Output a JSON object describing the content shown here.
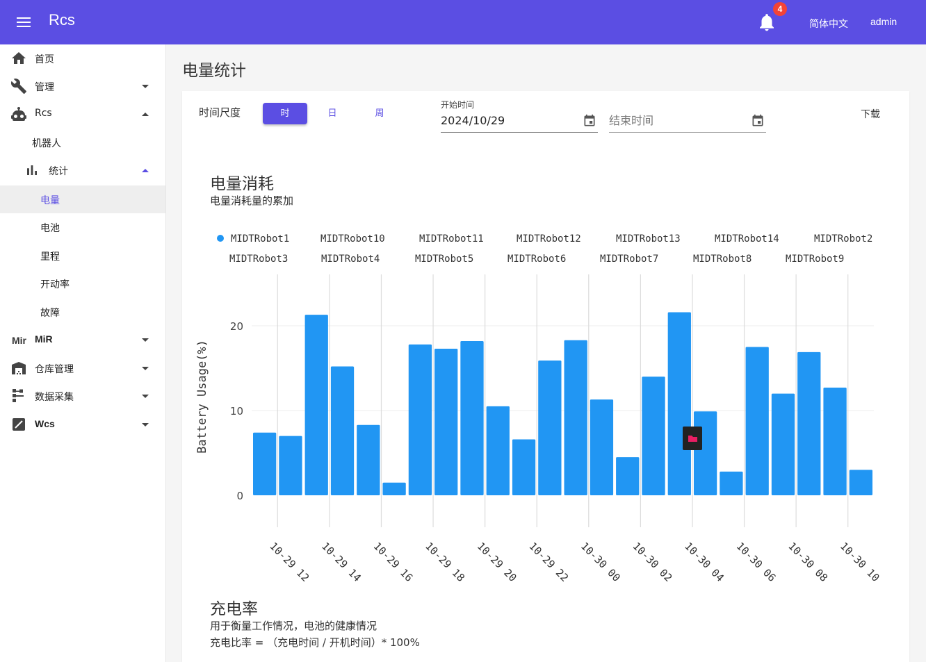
{
  "header": {
    "app_title": "Rcs",
    "notification_count": "4",
    "language": "简体中文",
    "user": "admin"
  },
  "sidebar": {
    "items": [
      {
        "label": "首页",
        "icon": "home-icon"
      },
      {
        "label": "管理",
        "icon": "wrench-icon"
      },
      {
        "label": "Rcs",
        "icon": "robot-icon"
      },
      {
        "label": "机器人"
      },
      {
        "label": "统计",
        "icon": "bar-chart-icon"
      },
      {
        "label": "电量"
      },
      {
        "label": "电池"
      },
      {
        "label": "里程"
      },
      {
        "label": "开动率"
      },
      {
        "label": "故障"
      },
      {
        "label": "MiR",
        "icon_text": "Mir"
      },
      {
        "label": "仓库管理",
        "icon": "warehouse-icon"
      },
      {
        "label": "数据采集",
        "icon": "data-collect-icon"
      },
      {
        "label": "Wcs",
        "icon": "wcs-icon"
      }
    ]
  },
  "page": {
    "title": "电量统计"
  },
  "filters": {
    "scale_label": "时间尺度",
    "scale_options": [
      "时",
      "日",
      "周"
    ],
    "start_label": "开始时间",
    "start_value": "2024/10/29",
    "end_placeholder": "结束时间",
    "download": "下载"
  },
  "consumption": {
    "title": "电量消耗",
    "subtitle": "电量消耗量的累加"
  },
  "charge_rate": {
    "title": "充电率",
    "line1": "用于衡量工作情况，电池的健康情况",
    "line2": "充电比率 = （充电时间 / 开机时间）* 100%"
  },
  "colors": {
    "accent": "#5b4ee3",
    "bar": "#2196f3",
    "badge": "#f44336"
  },
  "chart_data": {
    "type": "bar",
    "ylabel": "Battery Usage(%)",
    "ylim": [
      0,
      24
    ],
    "yticks": [
      0,
      10,
      20
    ],
    "grid": true,
    "legend_position": "top",
    "legend": [
      "MIDTRobot1",
      "MIDTRobot10",
      "MIDTRobot11",
      "MIDTRobot12",
      "MIDTRobot13",
      "MIDTRobot14",
      "MIDTRobot2",
      "MIDTRobot3",
      "MIDTRobot4",
      "MIDTRobot5",
      "MIDTRobot6",
      "MIDTRobot7",
      "MIDTRobot8",
      "MIDTRobot9"
    ],
    "x_tick_labels": [
      "10-29 12",
      "10-29 14",
      "10-29 16",
      "10-29 18",
      "10-29 20",
      "10-29 22",
      "10-30 00",
      "10-30 02",
      "10-30 04",
      "10-30 06",
      "10-30 08",
      "10-30 10"
    ],
    "values": [
      7.4,
      7.0,
      21.3,
      15.2,
      8.3,
      1.5,
      17.8,
      17.3,
      18.2,
      10.5,
      6.6,
      15.9,
      18.3,
      11.3,
      4.5,
      14.0,
      21.6,
      9.9,
      2.8,
      17.5,
      12.0,
      16.9,
      12.7,
      3.0
    ],
    "series": [
      {
        "name": "MIDTRobot1"
      }
    ]
  }
}
